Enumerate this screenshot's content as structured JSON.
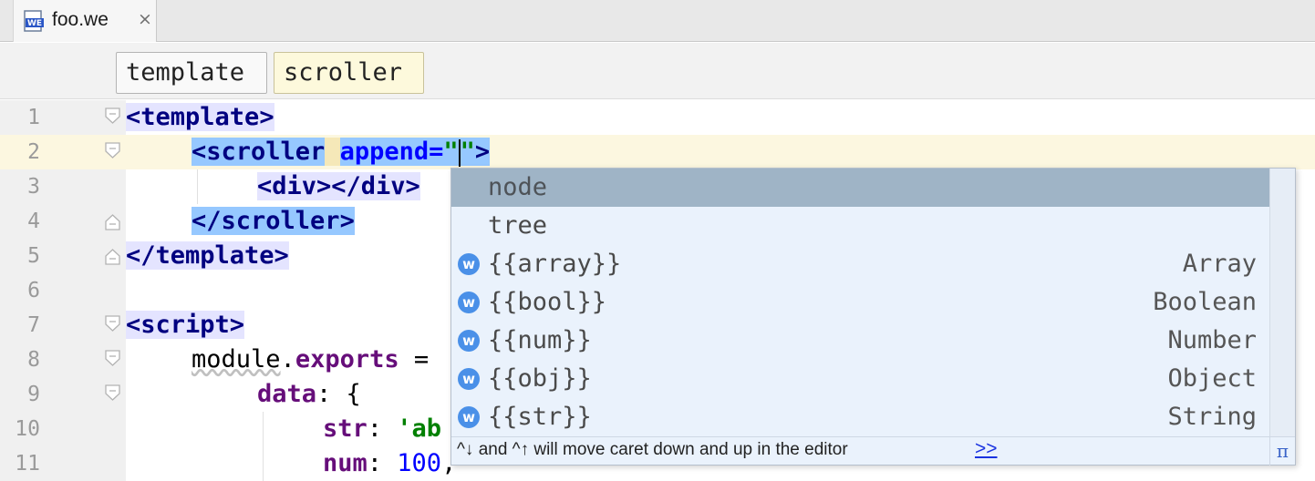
{
  "tab": {
    "label": "foo.we",
    "close": "×",
    "icon_text": "WE"
  },
  "breadcrumb": [
    "template",
    "scroller"
  ],
  "lines": [
    {
      "n": "1"
    },
    {
      "n": "2"
    },
    {
      "n": "3"
    },
    {
      "n": "4"
    },
    {
      "n": "5"
    },
    {
      "n": "6"
    },
    {
      "n": "7"
    },
    {
      "n": "8"
    },
    {
      "n": "9"
    },
    {
      "n": "10"
    },
    {
      "n": "11"
    }
  ],
  "code": {
    "l1": {
      "open": "<",
      "name": "template",
      "close": ">"
    },
    "l2": {
      "open": "<",
      "name": "scroller",
      "attr": "append",
      "eq": "=",
      "q1": "\"",
      "q2": "\"",
      "close": ">"
    },
    "l3": {
      "text": "<div></div>"
    },
    "l4": {
      "open": "</",
      "name": "scroller",
      "close": ">"
    },
    "l5": {
      "text": "</template>"
    },
    "l7": {
      "text": "<script>"
    },
    "l8": {
      "obj": "module",
      "dot": ".",
      "prop": "exports",
      "rest": " ="
    },
    "l9": {
      "prop": "data",
      "rest": ": {"
    },
    "l10": {
      "prop": "str",
      "colon": ": ",
      "str": "'ab"
    },
    "l11": {
      "prop": "num",
      "colon": ": ",
      "num": "100",
      "rest": ","
    }
  },
  "completion": {
    "items": [
      {
        "label": "node",
        "type": "",
        "icon": ""
      },
      {
        "label": "tree",
        "type": "",
        "icon": ""
      },
      {
        "label": "{{array}}",
        "type": "Array",
        "icon": "w"
      },
      {
        "label": "{{bool}}",
        "type": "Boolean",
        "icon": "w"
      },
      {
        "label": "{{num}}",
        "type": "Number",
        "icon": "w"
      },
      {
        "label": "{{obj}}",
        "type": "Object",
        "icon": "w"
      },
      {
        "label": "{{str}}",
        "type": "String",
        "icon": "w"
      }
    ],
    "hint": "^↓ and ^↑ will move caret down and up in the editor",
    "hint_link": ">>",
    "pi": "π"
  },
  "colors": {
    "current_line": "#fcf7e0",
    "selected_item": "#9fb4c6",
    "popup_bg": "#eaf2fc",
    "tag": "#000080",
    "attribute": "#0000ff",
    "string": "#008000",
    "property": "#660e7a"
  }
}
